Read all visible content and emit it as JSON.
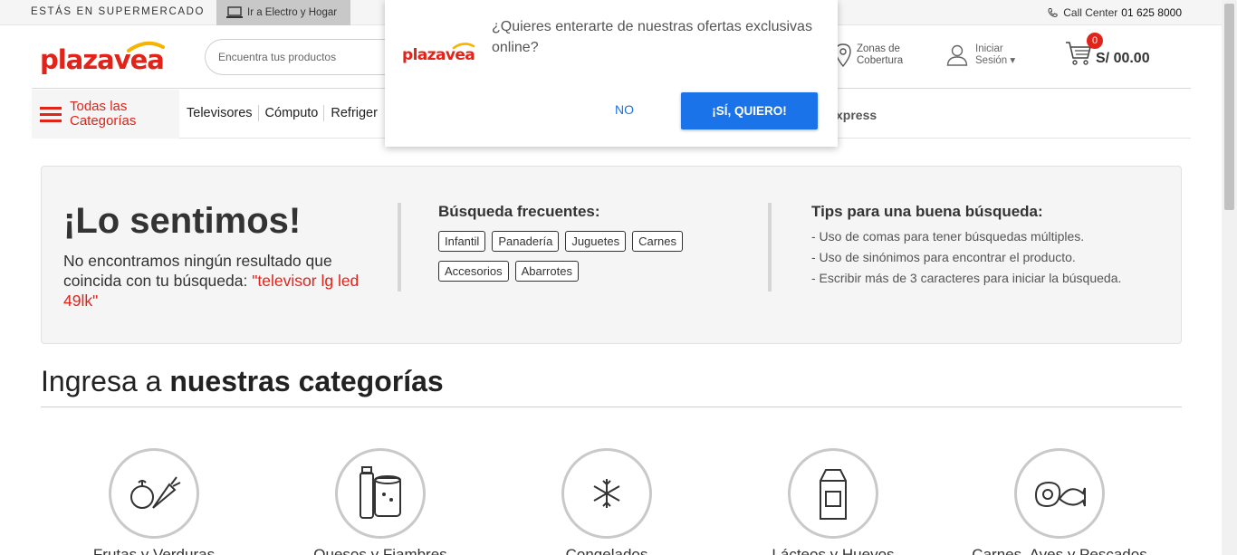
{
  "topbar": {
    "store_label": "ESTÁS EN SUPERMERCADO",
    "electro_link": "Ir a Electro y Hogar",
    "call_center_label": "Call Center",
    "call_center_number": "01 625 8000"
  },
  "header": {
    "logo_text": "plazavea",
    "search_placeholder": "Encuentra tus productos",
    "zones_label": "Zonas de Cobertura",
    "zones_line1": "Zonas de",
    "zones_line2": "Cobertura",
    "login_line1": "Iniciar",
    "login_line2": "Sesión ▾",
    "cart_count": "0",
    "cart_total": "S/ 00.00"
  },
  "nav": {
    "all_categories_line1": "Todas las",
    "all_categories_line2": "Categorías",
    "links": [
      "Televisores",
      "Cómputo",
      "Refriger"
    ],
    "express_label": "xpress"
  },
  "popup": {
    "message": "¿Quieres enterarte de nuestras ofertas exclusivas online?",
    "no_label": "NO",
    "yes_label": "¡SÍ, QUIERO!"
  },
  "no_results": {
    "title": "¡Lo sentimos!",
    "description": "No encontramos ningún resultado que coincida con tu búsqueda:",
    "query": "\"televisor lg led 49lk\"",
    "frequent_title": "Búsqueda frecuentes:",
    "frequent_searches": [
      "Infantil",
      "Panadería",
      "Juguetes",
      "Carnes",
      "Accesorios",
      "Abarrotes"
    ],
    "tips_title": "Tips para una buena búsqueda:",
    "tips": [
      "- Uso de comas para tener búsquedas múltiples.",
      "- Uso de sinónimos para encontrar el producto.",
      "- Escribir más de 3 caracteres para iniciar la búsqueda."
    ]
  },
  "categories": {
    "title_prefix": "Ingresa a",
    "title_bold": "nuestras categorías",
    "items": [
      {
        "name": "Frutas y Verduras",
        "icon": "fruits-vegetables-icon"
      },
      {
        "name": "Quesos y Fiambres",
        "icon": "cheese-deli-icon"
      },
      {
        "name": "Congelados",
        "icon": "snowflake-icon"
      },
      {
        "name": "Lácteos y Huevos",
        "icon": "milk-carton-icon"
      },
      {
        "name": "Carnes, Aves y Pescados",
        "icon": "meat-fish-icon"
      }
    ]
  },
  "colors": {
    "brand_red": "#e2231a",
    "brand_yellow": "#f4b400",
    "button_blue": "#1a73e8"
  }
}
